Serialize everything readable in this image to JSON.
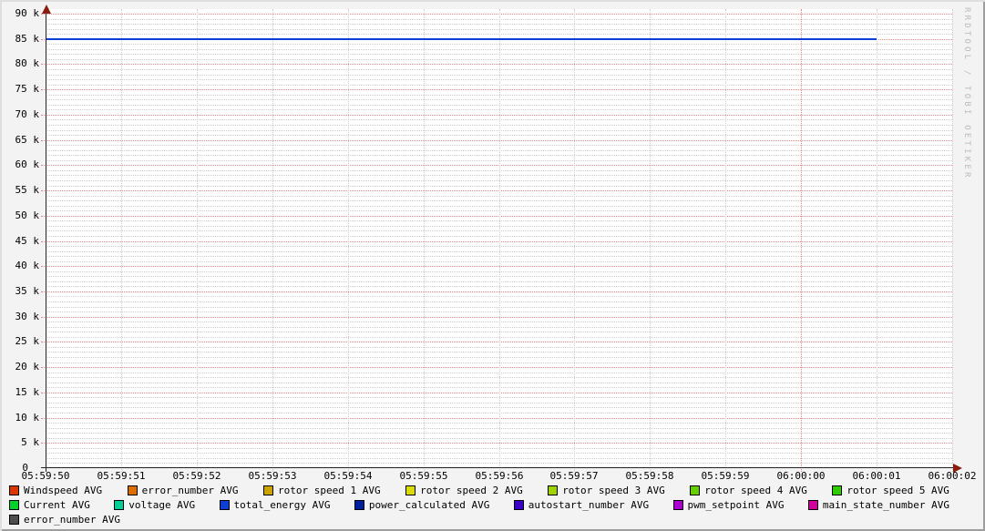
{
  "watermark": "RRDTOOL / TOBI OETIKER",
  "colors": {
    "background": "#F3F3F3",
    "canvas": "#FFFFFF",
    "grid_minor": "#CCCCCC",
    "grid_major": "#E58484",
    "axis": "#222222",
    "arrow": "#8B1D10",
    "watermark_text": "#BBBBBB"
  },
  "chart_data": {
    "type": "line",
    "title": "",
    "xlabel": "",
    "ylabel": "",
    "ylim": [
      0,
      90000
    ],
    "y_major_step": 5000,
    "y_minor_step": 1000,
    "grid": "dotted",
    "legend_position": "bottom",
    "x_ticks": [
      "05:59:50",
      "05:59:51",
      "05:59:52",
      "05:59:53",
      "05:59:54",
      "05:59:55",
      "05:59:56",
      "05:59:57",
      "05:59:58",
      "05:59:59",
      "06:00:00",
      "06:00:01",
      "06:00:02"
    ],
    "x_major_tick": "06:00:00",
    "y_ticks": [
      {
        "value": 90000,
        "label": "90 k"
      },
      {
        "value": 85000,
        "label": "85 k"
      },
      {
        "value": 80000,
        "label": "80 k"
      },
      {
        "value": 75000,
        "label": "75 k"
      },
      {
        "value": 70000,
        "label": "70 k"
      },
      {
        "value": 65000,
        "label": "65 k"
      },
      {
        "value": 60000,
        "label": "60 k"
      },
      {
        "value": 55000,
        "label": "55 k"
      },
      {
        "value": 50000,
        "label": "50 k"
      },
      {
        "value": 45000,
        "label": "45 k"
      },
      {
        "value": 40000,
        "label": "40 k"
      },
      {
        "value": 35000,
        "label": "35 k"
      },
      {
        "value": 30000,
        "label": "30 k"
      },
      {
        "value": 25000,
        "label": "25 k"
      },
      {
        "value": 20000,
        "label": "20 k"
      },
      {
        "value": 15000,
        "label": "15 k"
      },
      {
        "value": 10000,
        "label": "10 k"
      },
      {
        "value": 5000,
        "label": "5 k"
      },
      {
        "value": 0,
        "label": "0"
      }
    ],
    "series": [
      {
        "name": "total_energy AVG",
        "shape": "constant-line",
        "value": 85000,
        "x_start": "05:59:50",
        "x_end": "06:00:01",
        "color": "#0D3ED6",
        "line_width": 2
      }
    ]
  },
  "legend": {
    "rows": [
      [
        {
          "label": "Windspeed AVG",
          "color": "#DC3500"
        },
        {
          "label": "error_number AVG",
          "color": "#DC6E00"
        },
        {
          "label": "rotor speed 1 AVG",
          "color": "#CEA300"
        },
        {
          "label": "rotor speed 2 AVG",
          "color": "#DCDC00"
        },
        {
          "label": "rotor speed 3 AVG",
          "color": "#9DD300"
        },
        {
          "label": "rotor speed 4 AVG",
          "color": "#63CE00"
        },
        {
          "label": "rotor speed 5 AVG",
          "color": "#2CCC00"
        }
      ],
      [
        {
          "label": "Current AVG",
          "color": "#00D22A"
        },
        {
          "label": "voltage AVG",
          "color": "#00CE96"
        },
        {
          "label": "total_energy AVG",
          "color": "#0D3ED6"
        },
        {
          "label": "power_calculated AVG",
          "color": "#00209D"
        },
        {
          "label": "autostart_number AVG",
          "color": "#3B00C8"
        },
        {
          "label": "pwm_setpoint AVG",
          "color": "#AC00D0"
        },
        {
          "label": "main_state_number AVG",
          "color": "#D2009C"
        }
      ],
      [
        {
          "label": "error_number AVG",
          "color": "#4D4D4D"
        }
      ]
    ]
  }
}
